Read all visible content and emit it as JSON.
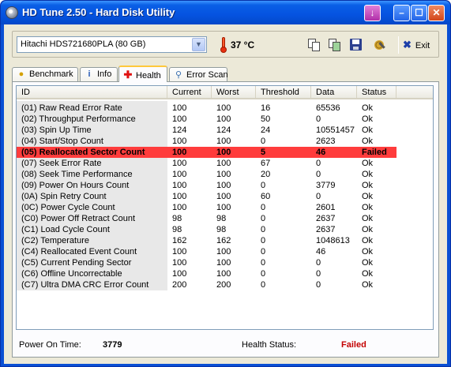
{
  "window": {
    "title": "HD Tune 2.50 - Hard Disk Utility",
    "titlebar_color": "#0553e0"
  },
  "toolbar": {
    "drive": "Hitachi HDS721680PLA (80 GB)",
    "temperature": "37 °C",
    "exit_label": "Exit",
    "icons": [
      "copy-text-icon",
      "copy-screenshot-icon",
      "save-icon",
      "options-icon"
    ]
  },
  "tabs": [
    {
      "label": "Benchmark",
      "icon": "lightbulb-icon"
    },
    {
      "label": "Info",
      "icon": "info-icon"
    },
    {
      "label": "Health",
      "icon": "health-cross-icon",
      "active": true
    },
    {
      "label": "Error Scan",
      "icon": "magnifier-icon"
    }
  ],
  "table": {
    "columns": [
      "ID",
      "Current",
      "Worst",
      "Threshold",
      "Data",
      "Status"
    ],
    "rows": [
      {
        "id": "(01) Raw Read Error Rate",
        "current": "100",
        "worst": "100",
        "threshold": "16",
        "data": "65536",
        "status": "Ok"
      },
      {
        "id": "(02) Throughput Performance",
        "current": "100",
        "worst": "100",
        "threshold": "50",
        "data": "0",
        "status": "Ok"
      },
      {
        "id": "(03) Spin Up Time",
        "current": "124",
        "worst": "124",
        "threshold": "24",
        "data": "10551457",
        "status": "Ok"
      },
      {
        "id": "(04) Start/Stop Count",
        "current": "100",
        "worst": "100",
        "threshold": "0",
        "data": "2623",
        "status": "Ok"
      },
      {
        "id": "(05) Reallocated Sector Count",
        "current": "100",
        "worst": "100",
        "threshold": "5",
        "data": "46",
        "status": "Failed",
        "failed": true
      },
      {
        "id": "(07) Seek Error Rate",
        "current": "100",
        "worst": "100",
        "threshold": "67",
        "data": "0",
        "status": "Ok"
      },
      {
        "id": "(08) Seek Time Performance",
        "current": "100",
        "worst": "100",
        "threshold": "20",
        "data": "0",
        "status": "Ok"
      },
      {
        "id": "(09) Power On Hours Count",
        "current": "100",
        "worst": "100",
        "threshold": "0",
        "data": "3779",
        "status": "Ok"
      },
      {
        "id": "(0A) Spin Retry Count",
        "current": "100",
        "worst": "100",
        "threshold": "60",
        "data": "0",
        "status": "Ok"
      },
      {
        "id": "(0C) Power Cycle Count",
        "current": "100",
        "worst": "100",
        "threshold": "0",
        "data": "2601",
        "status": "Ok"
      },
      {
        "id": "(C0) Power Off Retract Count",
        "current": "98",
        "worst": "98",
        "threshold": "0",
        "data": "2637",
        "status": "Ok"
      },
      {
        "id": "(C1) Load Cycle Count",
        "current": "98",
        "worst": "98",
        "threshold": "0",
        "data": "2637",
        "status": "Ok"
      },
      {
        "id": "(C2) Temperature",
        "current": "162",
        "worst": "162",
        "threshold": "0",
        "data": "1048613",
        "status": "Ok"
      },
      {
        "id": "(C4) Reallocated Event Count",
        "current": "100",
        "worst": "100",
        "threshold": "0",
        "data": "46",
        "status": "Ok"
      },
      {
        "id": "(C5) Current Pending Sector",
        "current": "100",
        "worst": "100",
        "threshold": "0",
        "data": "0",
        "status": "Ok"
      },
      {
        "id": "(C6) Offline Uncorrectable",
        "current": "100",
        "worst": "100",
        "threshold": "0",
        "data": "0",
        "status": "Ok"
      },
      {
        "id": "(C7) Ultra DMA CRC Error Count",
        "current": "200",
        "worst": "200",
        "threshold": "0",
        "data": "0",
        "status": "Ok"
      }
    ],
    "failed_color": "#ff3c3c"
  },
  "footer": {
    "power_on_label": "Power On Time:",
    "power_on_value": "3779",
    "health_label": "Health Status:",
    "health_value": "Failed",
    "health_color": "#c40000"
  }
}
